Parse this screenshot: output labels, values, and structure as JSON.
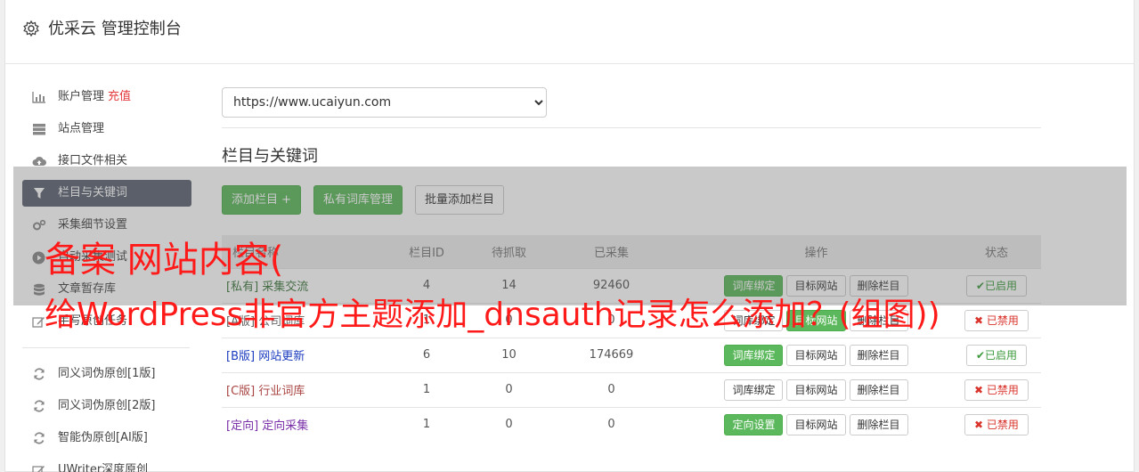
{
  "header": {
    "title": "优采云 管理控制台"
  },
  "sidebar": {
    "items": [
      {
        "label": "账户管理",
        "extra": "充值",
        "icon": "bar-chart-icon"
      },
      {
        "label": "站点管理",
        "icon": "server-icon"
      },
      {
        "label": "接口文件相关",
        "icon": "cloud-upload-icon"
      },
      {
        "label": "栏目与关键词",
        "icon": "filter-icon",
        "active": true
      },
      {
        "label": "采集细节设置",
        "icon": "cogs-icon"
      },
      {
        "label": "自动采集测试",
        "icon": "play-circle-icon"
      },
      {
        "label": "文章暂存库",
        "icon": "database-icon"
      },
      {
        "label": "手写原创任务",
        "icon": "edit-icon"
      }
    ],
    "items2": [
      {
        "label": "同义词伪原创[1版]",
        "icon": "refresh-icon"
      },
      {
        "label": "同义词伪原创[2版]",
        "icon": "refresh-icon"
      },
      {
        "label": "智能伪原创[AI版]",
        "icon": "refresh-icon"
      },
      {
        "label": "UWriter深度原创",
        "icon": "edit-icon"
      }
    ]
  },
  "main": {
    "site_select": "https://www.ucaiyun.com",
    "section_title": "栏目与关键词",
    "buttons": {
      "add": "添加栏目 +",
      "private": "私有词库管理",
      "batch": "批量添加栏目"
    },
    "table": {
      "headers": [
        "栏目名称",
        "栏目ID",
        "待抓取",
        "已采集",
        "操作",
        "状态"
      ],
      "rows": [
        {
          "tag": "[私有]",
          "name": "采集交流",
          "id": "4",
          "pending": "14",
          "collected": "92460",
          "op1": "词库绑定",
          "op2": "目标网站",
          "op3": "删除栏目",
          "status": "已启用"
        },
        {
          "tag": "[A版]",
          "name": "公司词库",
          "id": "1",
          "pending": "0",
          "collected": "0",
          "op1": "词库绑定",
          "op2": "目标网站",
          "op3": "删除栏目",
          "status": "已禁用"
        },
        {
          "tag": "[B版]",
          "name": "网站更新",
          "id": "6",
          "pending": "10",
          "collected": "174669",
          "op1": "词库绑定",
          "op2": "目标网站",
          "op3": "删除栏目",
          "status": "已启用"
        },
        {
          "tag": "[C版]",
          "name": "行业词库",
          "id": "1",
          "pending": "0",
          "collected": "0",
          "op1": "词库绑定",
          "op2": "目标网站",
          "op3": "删除栏目",
          "status": "已禁用"
        },
        {
          "tag": "[定向]",
          "name": "定向采集",
          "id": "1",
          "pending": "0",
          "collected": "0",
          "op1": "定向设置",
          "op2": "目标网站",
          "op3": "删除栏目",
          "status": "已禁用"
        }
      ]
    }
  },
  "watermark": {
    "line1": "备案 网站内容(",
    "line2": "给WordPress非官方主题添加_dnsauth记录怎么添加？(组图))"
  },
  "colors": {
    "accent_green": "#5cb85c",
    "active_nav": "#5a6170",
    "danger": "#d9332b",
    "watermark": "#ff1a1a"
  }
}
